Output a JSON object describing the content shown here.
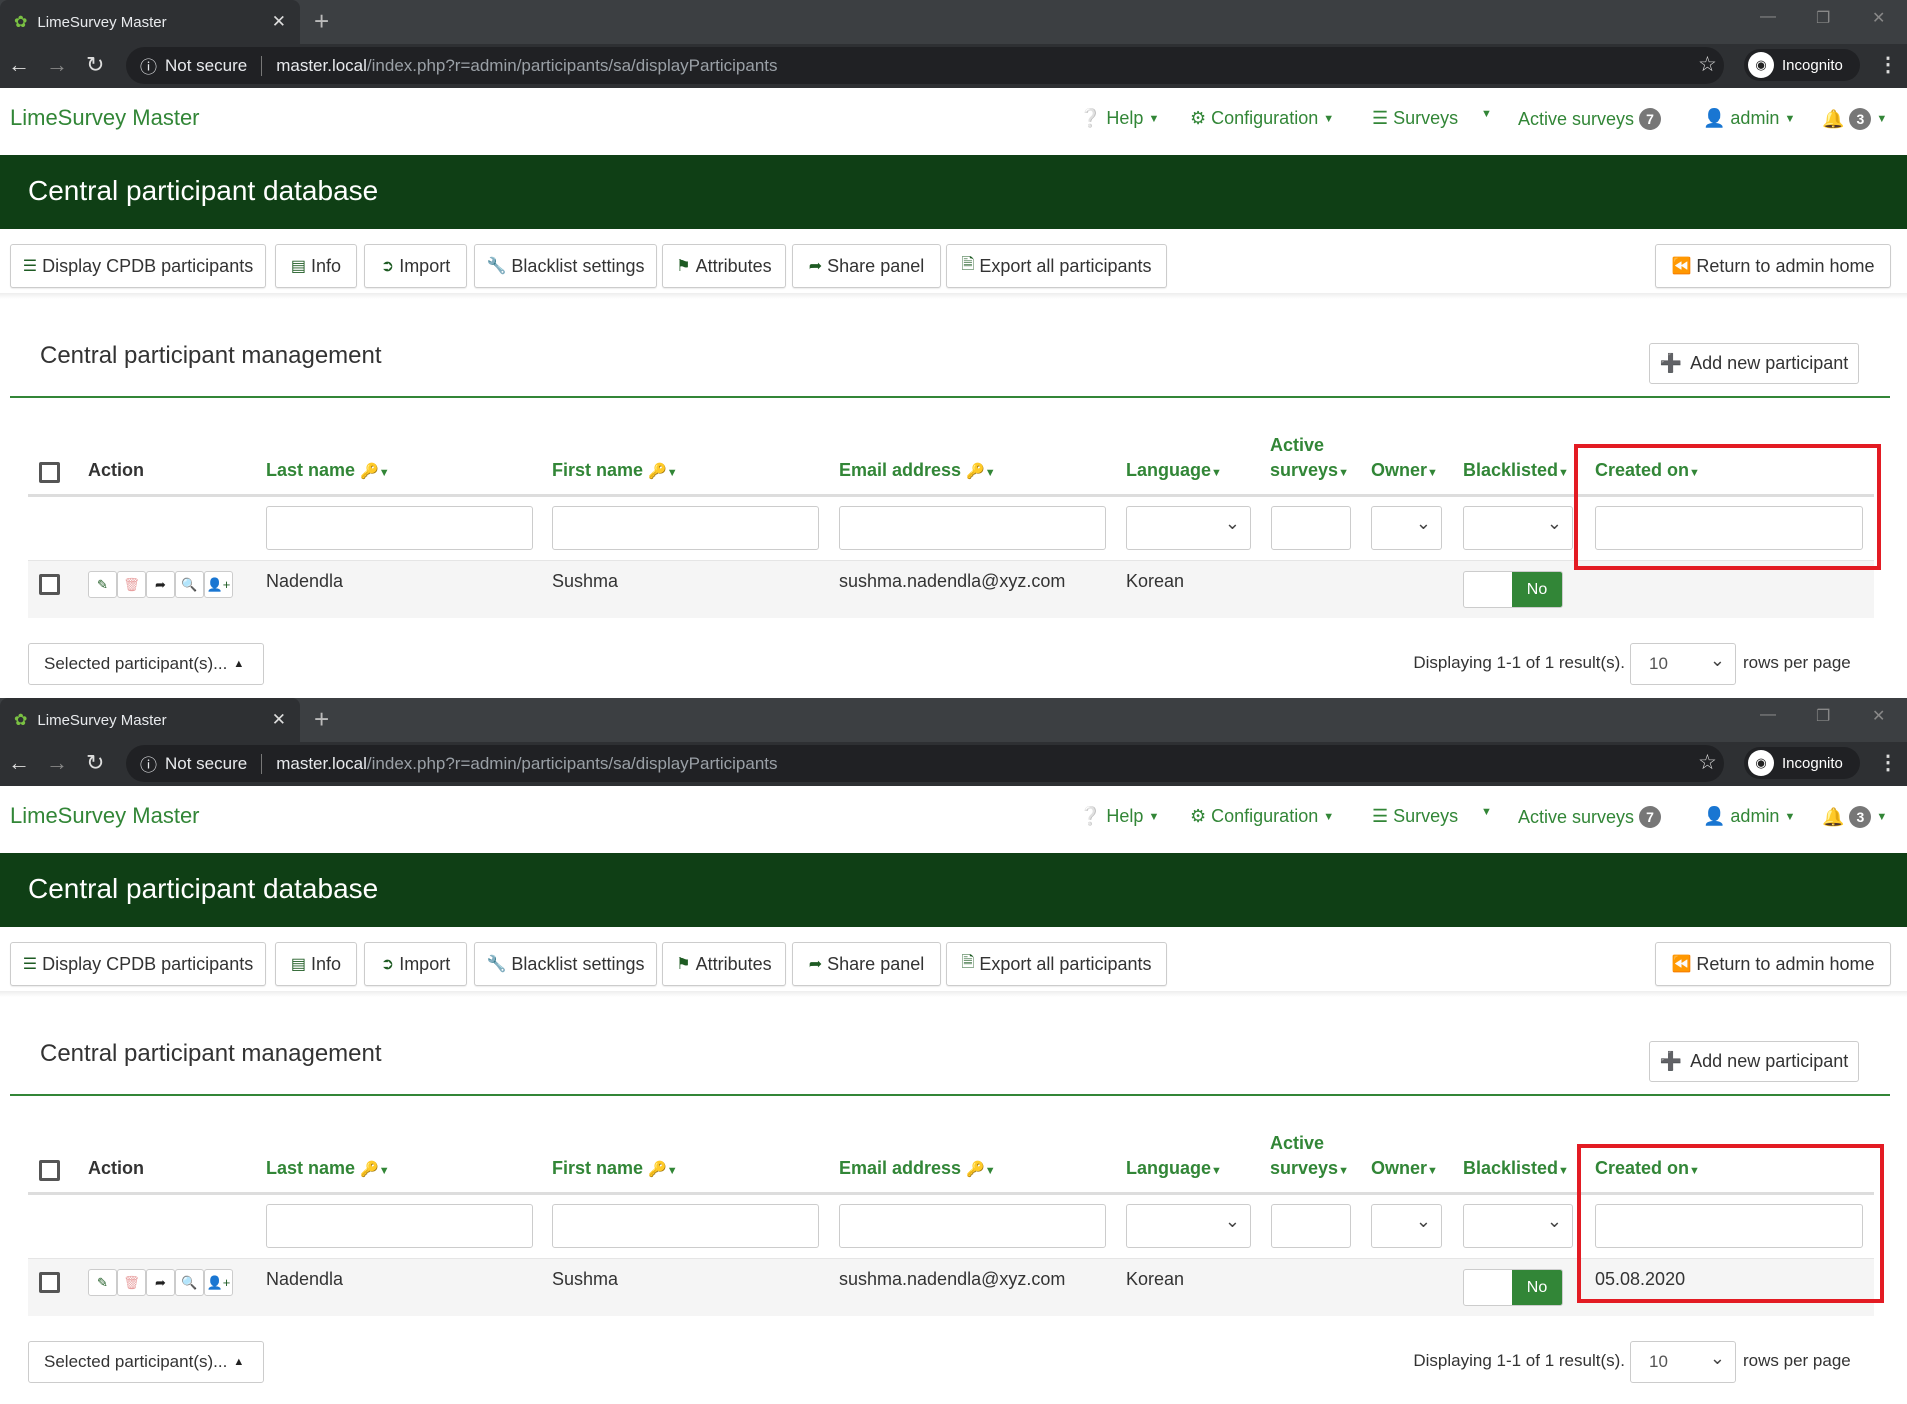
{
  "browser": {
    "tab_title": "LimeSurvey Master",
    "not_secure": "Not secure",
    "url_host": "master.local",
    "url_path": "/index.php?r=admin/participants/sa/displayParticipants",
    "incognito": "Incognito"
  },
  "navbar": {
    "brand": "LimeSurvey Master",
    "help": "Help",
    "configuration": "Configuration",
    "surveys": "Surveys",
    "active_surveys": "Active surveys",
    "active_surveys_count": "7",
    "user": "admin",
    "notifications_count": "3"
  },
  "banner": {
    "title": "Central participant database"
  },
  "toolbar": {
    "display": "Display CPDB participants",
    "info": "Info",
    "import": "Import",
    "blacklist": "Blacklist settings",
    "attributes": "Attributes",
    "share": "Share panel",
    "export": "Export all participants",
    "return": "Return to admin home"
  },
  "section": {
    "title": "Central participant management",
    "add_button": "Add new participant"
  },
  "table": {
    "headers": {
      "action": "Action",
      "last_name": "Last name",
      "first_name": "First name",
      "email": "Email address",
      "language": "Language",
      "active_surveys_1": "Active",
      "active_surveys_2": "surveys",
      "owner": "Owner",
      "blacklisted": "Blacklisted",
      "created_on": "Created on"
    },
    "row": {
      "last_name": "Nadendla",
      "first_name": "Sushma",
      "email": "sushma.nadendla@xyz.com",
      "language": "Korean",
      "blacklisted": "No"
    }
  },
  "footer": {
    "selected": "Selected participant(s)...",
    "displaying": "Displaying 1-1 of 1 result(s).",
    "rows_value": "10",
    "rows_label": "rows per page"
  },
  "panes": [
    {
      "created_on": null
    },
    {
      "created_on": "05.08.2020"
    }
  ],
  "colors": {
    "brand_green": "#328637",
    "banner": "#0f3f15",
    "highlight": "#e31b23"
  }
}
